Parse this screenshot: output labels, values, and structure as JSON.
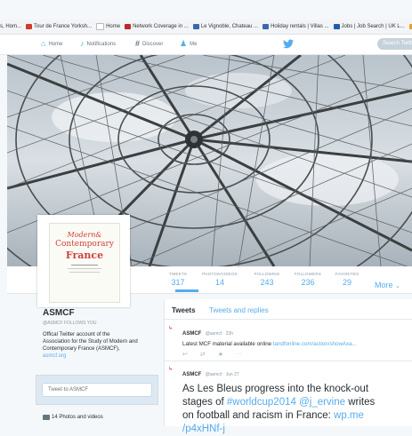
{
  "browser": {
    "bookmarks": [
      {
        "label": "s, Hom...",
        "color": "#ffffff"
      },
      {
        "label": "Tour de France Yorksh...",
        "color": "#d23a2a"
      },
      {
        "label": "Home",
        "color": "#ffffff"
      },
      {
        "label": "Network Coverage in ...",
        "color": "#c0262d"
      },
      {
        "label": "Le Vignoble, Chateau ...",
        "color": "#3c66b0"
      },
      {
        "label": "Holiday rentals | Villas ...",
        "color": "#3c66b0"
      },
      {
        "label": "Jobs | Job Search | UK L...",
        "color": "#1f5fa8"
      },
      {
        "label": "Home",
        "color": "#e8a030"
      }
    ]
  },
  "nav": {
    "home": "Home",
    "notifications": "Notifications",
    "discover": "Discover",
    "me": "Me",
    "search_placeholder": "Search Twitte",
    "icons": {
      "home": "home-icon",
      "notifications": "bell-icon",
      "discover": "hashtag-icon",
      "me": "person-icon",
      "logo": "twitter-bird-icon"
    }
  },
  "avatar": {
    "line1": "Modern&",
    "line2": "Contemporary",
    "line3": "France"
  },
  "stats": {
    "tweets": {
      "label": "TWEETS",
      "value": "317"
    },
    "photos": {
      "label": "PHOTOS/VIDEOS",
      "value": "14"
    },
    "following": {
      "label": "FOLLOWING",
      "value": "243"
    },
    "followers": {
      "label": "FOLLOWERS",
      "value": "236"
    },
    "favorites": {
      "label": "FAVORITES",
      "value": "29"
    },
    "more": "More"
  },
  "profile": {
    "name": "ASMCF",
    "handle": "@ASMCF  FOLLOWS YOU",
    "bio_line1": "Offical Twitter account of the",
    "bio_line2": "Association for the Study of Modern and",
    "bio_line3": "Contemporary France (ASMCF),",
    "bio_line4": "asmcf.org",
    "tweet_to": "Tweet to ASMCF",
    "photos_link": "14 Photos and videos"
  },
  "timeline": {
    "tab_tweets": "Tweets",
    "tab_replies": "Tweets and replies",
    "tweets": [
      {
        "name": "ASMCF",
        "handle": "@asmcf · 23h",
        "text": "Latest MCF material available online",
        "link": "tandfonline.com/action/showAxa..."
      },
      {
        "name": "ASMCF",
        "handle": "@asmcf · Jun 27",
        "line1": "As Les Bleus progress into the knock-out",
        "line2a": "stages of ",
        "line2b": "#worldcup2014",
        "line2c": " @j_ervine",
        "line2d": " writes",
        "line3a": "on football and racism in France: ",
        "line3b": "wp.me",
        "line4": "/p4xHNf-j"
      }
    ]
  }
}
